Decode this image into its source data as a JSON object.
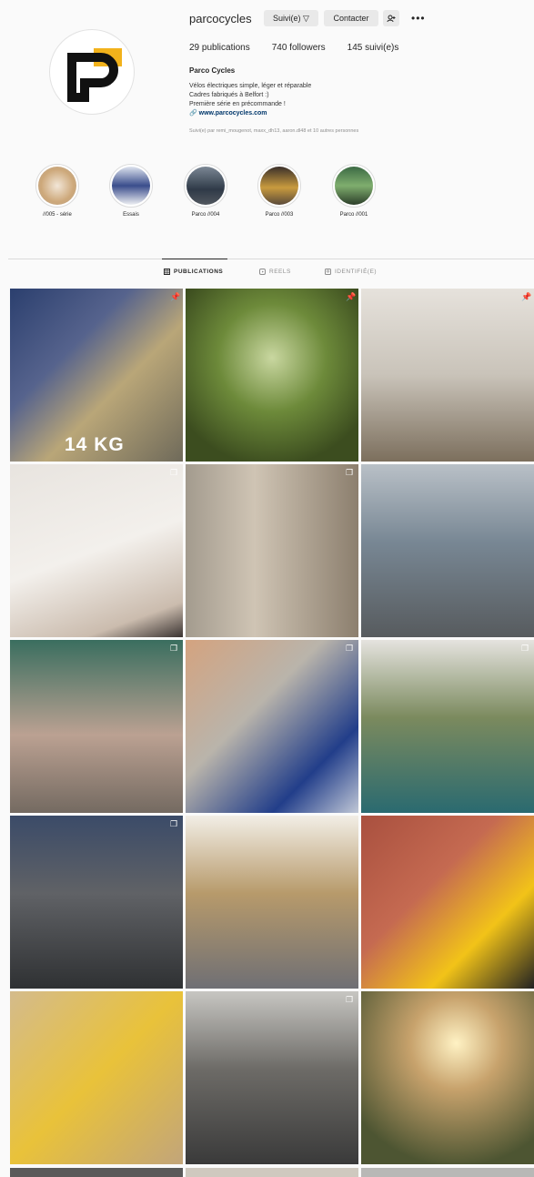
{
  "profile": {
    "username": "parcocycles",
    "follow_button": "Suivi(e) ▽",
    "contact_button": "Contacter",
    "suggest_icon": "person-add-icon",
    "more_icon": "•••",
    "stats": {
      "publications": "29 publications",
      "followers": "740 followers",
      "following": "145 suivi(e)s"
    },
    "full_name": "Parco Cycles",
    "bio_lines": [
      "Vélos électriques simple, léger et réparable",
      "Cadres fabriqués à Belfort :)",
      "Première série en précommande !"
    ],
    "website": "www.parcocycles.com",
    "followed_by": "Suivi(e) par remi_mougenot, maxx_dh13, aaron.dl48 et 10 autres personnes"
  },
  "highlights": [
    {
      "label": "//005 - série"
    },
    {
      "label": "Essais"
    },
    {
      "label": "Parco //004"
    },
    {
      "label": "Parco //003"
    },
    {
      "label": "Parco //001"
    }
  ],
  "tabs": [
    {
      "label": "PUBLICATIONS",
      "icon": "grid-icon"
    },
    {
      "label": "REELS",
      "icon": "reels-icon"
    },
    {
      "label": "IDENTIFIÉ(E)",
      "icon": "tag-icon"
    }
  ],
  "posts": {
    "first_overlay_text": "14 KG"
  },
  "colors": {
    "brand_yellow": "#f2b21b",
    "text": "#262626",
    "muted": "#8e8e8e",
    "link": "#00376b"
  }
}
